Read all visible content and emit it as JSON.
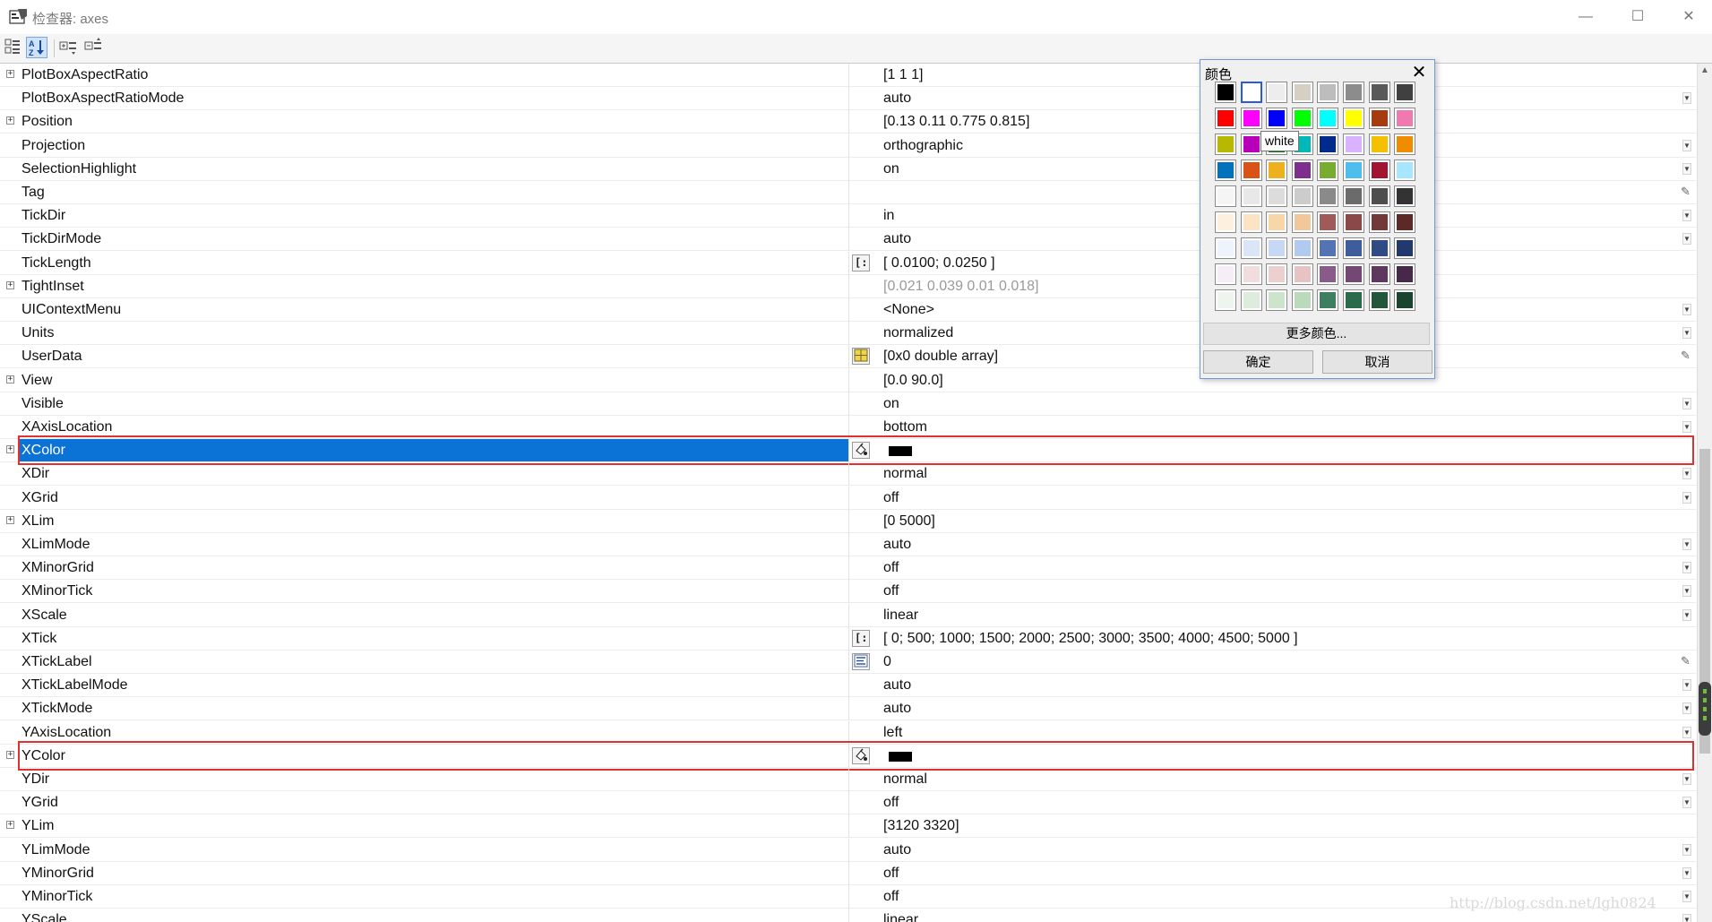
{
  "window": {
    "title": "检查器: axes",
    "minimize": "—",
    "maximize": "☐",
    "close": "✕"
  },
  "toolbar": {
    "buttons": [
      {
        "name": "categorize-icon",
        "active": false
      },
      {
        "name": "sort-alphabetical-icon",
        "active": true
      },
      {
        "name": "expand-all-icon",
        "active": false
      },
      {
        "name": "collapse-all-icon",
        "active": false
      }
    ]
  },
  "properties": [
    {
      "name": "PlotBoxAspectRatio",
      "value": "[1 1 1]",
      "expander": true,
      "control": "none"
    },
    {
      "name": "PlotBoxAspectRatioMode",
      "value": "auto",
      "control": "dropdown"
    },
    {
      "name": "Position",
      "value": "[0.13 0.11 0.775 0.815]",
      "expander": true,
      "control": "none"
    },
    {
      "name": "Projection",
      "value": "orthographic",
      "control": "dropdown"
    },
    {
      "name": "SelectionHighlight",
      "value": "on",
      "control": "dropdown"
    },
    {
      "name": "Tag",
      "value": "",
      "control": "pencil"
    },
    {
      "name": "TickDir",
      "value": "in",
      "control": "dropdown"
    },
    {
      "name": "TickDirMode",
      "value": "auto",
      "control": "dropdown"
    },
    {
      "name": "TickLength",
      "value": "[ 0.0100; 0.0250 ]",
      "editor": "array",
      "control": "none"
    },
    {
      "name": "TightInset",
      "value": "[0.021 0.039 0.01 0.018]",
      "expander": true,
      "dim": true,
      "control": "none"
    },
    {
      "name": "UIContextMenu",
      "value": "<None>",
      "control": "dropdown"
    },
    {
      "name": "Units",
      "value": "normalized",
      "control": "dropdown"
    },
    {
      "name": "UserData",
      "value": "[0x0  double array]",
      "editor": "table",
      "control": "pencil"
    },
    {
      "name": "View",
      "value": "[0.0 90.0]",
      "expander": true,
      "control": "none"
    },
    {
      "name": "Visible",
      "value": "on",
      "control": "dropdown"
    },
    {
      "name": "XAxisLocation",
      "value": "bottom",
      "control": "dropdown"
    },
    {
      "name": "XColor",
      "value": "",
      "expander": true,
      "editor": "color",
      "swatch": "#000000",
      "selected": true,
      "highlight": true,
      "control": "none"
    },
    {
      "name": "XDir",
      "value": "normal",
      "control": "dropdown"
    },
    {
      "name": "XGrid",
      "value": "off",
      "control": "dropdown"
    },
    {
      "name": "XLim",
      "value": "[0 5000]",
      "expander": true,
      "control": "none"
    },
    {
      "name": "XLimMode",
      "value": "auto",
      "control": "dropdown"
    },
    {
      "name": "XMinorGrid",
      "value": "off",
      "control": "dropdown"
    },
    {
      "name": "XMinorTick",
      "value": "off",
      "control": "dropdown"
    },
    {
      "name": "XScale",
      "value": "linear",
      "control": "dropdown"
    },
    {
      "name": "XTick",
      "value": "[ 0; 500; 1000; 1500; 2000; 2500; 3000; 3500; 4000; 4500; 5000 ]",
      "editor": "array",
      "control": "none"
    },
    {
      "name": "XTickLabel",
      "value": "0",
      "editor": "text",
      "control": "pencil"
    },
    {
      "name": "XTickLabelMode",
      "value": "auto",
      "control": "dropdown"
    },
    {
      "name": "XTickMode",
      "value": "auto",
      "control": "dropdown"
    },
    {
      "name": "YAxisLocation",
      "value": "left",
      "control": "dropdown"
    },
    {
      "name": "YColor",
      "value": "",
      "expander": true,
      "editor": "color",
      "swatch": "#000000",
      "highlight": true,
      "control": "none"
    },
    {
      "name": "YDir",
      "value": "normal",
      "control": "dropdown"
    },
    {
      "name": "YGrid",
      "value": "off",
      "control": "dropdown"
    },
    {
      "name": "YLim",
      "value": "[3120 3320]",
      "expander": true,
      "control": "none"
    },
    {
      "name": "YLimMode",
      "value": "auto",
      "control": "dropdown"
    },
    {
      "name": "YMinorGrid",
      "value": "off",
      "control": "dropdown"
    },
    {
      "name": "YMinorTick",
      "value": "off",
      "control": "dropdown"
    },
    {
      "name": "YScale",
      "value": "linear",
      "control": "dropdown"
    }
  ],
  "color_popup": {
    "title": "颜色",
    "tooltip": "white",
    "selected_color": "#ffffff",
    "more_colors_label": "更多颜色...",
    "ok_label": "确定",
    "cancel_label": "取消",
    "palette": [
      [
        "#000000",
        "#ffffff",
        "#ededed",
        "#d6cfc4",
        "#bdbdbd",
        "#8c8c8c",
        "#595959",
        "#404040"
      ],
      [
        "#ff0000",
        "#ff00ff",
        "#0000ff",
        "#00ff00",
        "#00ffff",
        "#ffff00",
        "#a83a10",
        "#f07ab0"
      ],
      [
        "#b8b800",
        "#b800b8",
        "#007a00",
        "#00b8b8",
        "#002a8c",
        "#d9b3ff",
        "#f5c000",
        "#f08c00"
      ],
      [
        "#0072bd",
        "#d95319",
        "#edb120",
        "#7e2f8e",
        "#77ac30",
        "#4dbeee",
        "#a2142f",
        "#a6e6ff"
      ],
      [
        "#f5f5f5",
        "#e8e8e8",
        "#dcdcdc",
        "#cccccc",
        "#8a8a8a",
        "#6b6b6b",
        "#4d4d4d",
        "#333333"
      ],
      [
        "#fdf0dc",
        "#fbe3c4",
        "#f7d7a8",
        "#f2c79a",
        "#a05a5a",
        "#8a4848",
        "#733838",
        "#5c2828"
      ],
      [
        "#eef3fc",
        "#dae6f8",
        "#c7d8f4",
        "#b3caf0",
        "#5473b4",
        "#3f5d9c",
        "#2f4a84",
        "#23386c"
      ],
      [
        "#f6eef6",
        "#f1dddd",
        "#ecd0d0",
        "#e7c3c3",
        "#8a5a8a",
        "#744874",
        "#5e385e",
        "#482848"
      ],
      [
        "#eef5ee",
        "#ddecdd",
        "#cce3cc",
        "#bbdabb",
        "#3c8060",
        "#2c6a4c",
        "#22573c",
        "#1a442e"
      ]
    ]
  },
  "watermark": "http://blog.csdn.net/lgh0824"
}
